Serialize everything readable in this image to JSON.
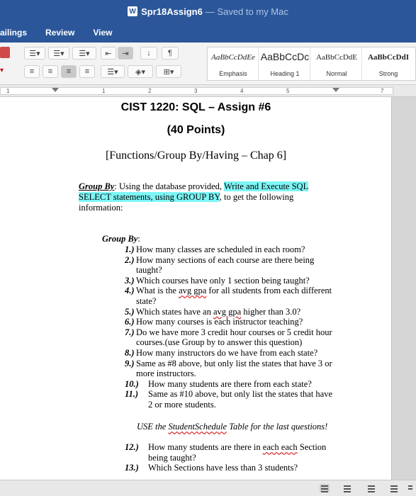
{
  "titlebar": {
    "doc_icon": "W",
    "title": "Spr18Assign6",
    "saved": " — Saved to my Mac"
  },
  "tabs": [
    {
      "label": "ailings"
    },
    {
      "label": "Review"
    },
    {
      "label": "View"
    }
  ],
  "ribbon": {
    "para_icons": [
      "bullets-icon",
      "numbering-icon",
      "multilevel-icon",
      "decrease-indent-icon",
      "increase-indent-icon",
      "sort-icon",
      "pilcrow-icon",
      "align-left-icon",
      "align-center-icon",
      "align-right-icon",
      "justify-icon",
      "line-spacing-icon",
      "shading-icon",
      "borders-icon"
    ],
    "styles": [
      {
        "sample": "AaBbCcDdEe",
        "name": "Emphasis"
      },
      {
        "sample": "AaBbCcDc",
        "name": "Heading 1"
      },
      {
        "sample": "AaBbCcDdE",
        "name": "Normal"
      },
      {
        "sample": "AaBbCcDdI",
        "name": "Strong"
      }
    ]
  },
  "ruler": {
    "numbers": [
      "1",
      "1",
      "2",
      "3",
      "4",
      "5",
      "6",
      "7"
    ]
  },
  "document": {
    "title": "CIST 1220: SQL – Assign #6",
    "points": "(40 Points)",
    "subtitle": "[Functions/Group By/Having – Chap 6]",
    "intro": {
      "label": "Group By",
      "colon": ": Using the database provided, ",
      "highlight": "Write and Execute SQL SELECT statements, using GROUP BY",
      "rest": ", to get the following information:"
    },
    "section_label": "Group By",
    "section_colon": ":",
    "questions": [
      {
        "n": "1.)",
        "text": "How many classes are scheduled in each room?"
      },
      {
        "n": "2.)",
        "text": "How many sections of each course are there being taught?"
      },
      {
        "n": "3.)",
        "text": "Which courses have only 1 section being taught?"
      },
      {
        "n": "4.)",
        "text": "What is the avg gpa for all students from each different state?"
      },
      {
        "n": "5.)",
        "text": "Which states have an avg gpa higher than 3.0?"
      },
      {
        "n": "6.)",
        "text": "How many courses is each instructor teaching?"
      },
      {
        "n": "7.)",
        "text": "Do we have more 3 credit hour courses or 5 credit hour courses.(use Group by to answer this question)"
      },
      {
        "n": "8.)",
        "text": "How many instructors do we have from each state?"
      },
      {
        "n": "9.)",
        "text": "Same as #8 above, but only list the states that have 3 or more instructors."
      },
      {
        "n": "10.)",
        "text": "How many students are there from each state?"
      },
      {
        "n": "11.)",
        "text": "Same as #10 above, but only list the states that have 2 or more students."
      }
    ],
    "note": "USE the StudentSchedule Table for the last questions!",
    "questions2": [
      {
        "n": "12.)",
        "text": "How many students are there in each each Section being taught?"
      },
      {
        "n": "13.)",
        "text": "Which Sections have less than 3 students?"
      }
    ]
  },
  "statusbar": {
    "view_icons": [
      "print-layout-icon",
      "web-layout-icon",
      "outline-icon",
      "draft-icon",
      "focus-icon"
    ]
  }
}
